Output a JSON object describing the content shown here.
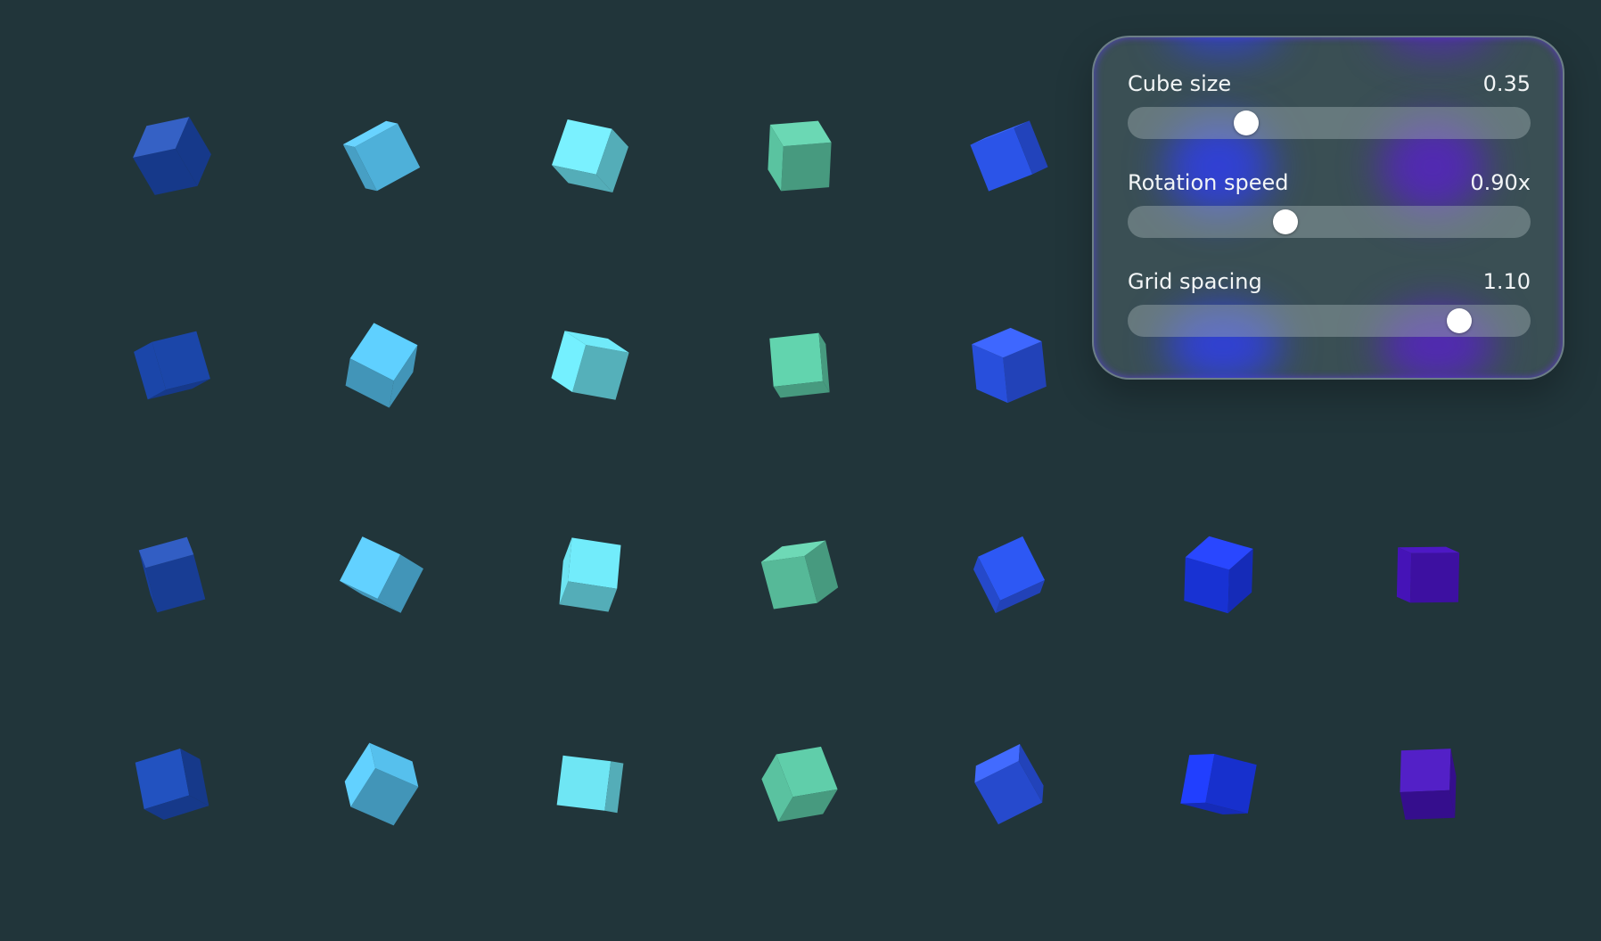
{
  "scene": {
    "background": "#21353a",
    "palette": [
      "#1f4fbf",
      "#5ccfff",
      "#74f0ff",
      "#63d6b0",
      "#2f5cff",
      "#1d3cff",
      "#4a14c4"
    ],
    "rows": 4,
    "columns": 7
  },
  "controls": {
    "cube_size": {
      "label": "Cube size",
      "value": "0.35",
      "fraction": 0.28
    },
    "rotation_speed": {
      "label": "Rotation speed",
      "value": "0.90x",
      "fraction": 0.385
    },
    "grid_spacing": {
      "label": "Grid spacing",
      "value": "1.10",
      "fraction": 0.845
    }
  }
}
